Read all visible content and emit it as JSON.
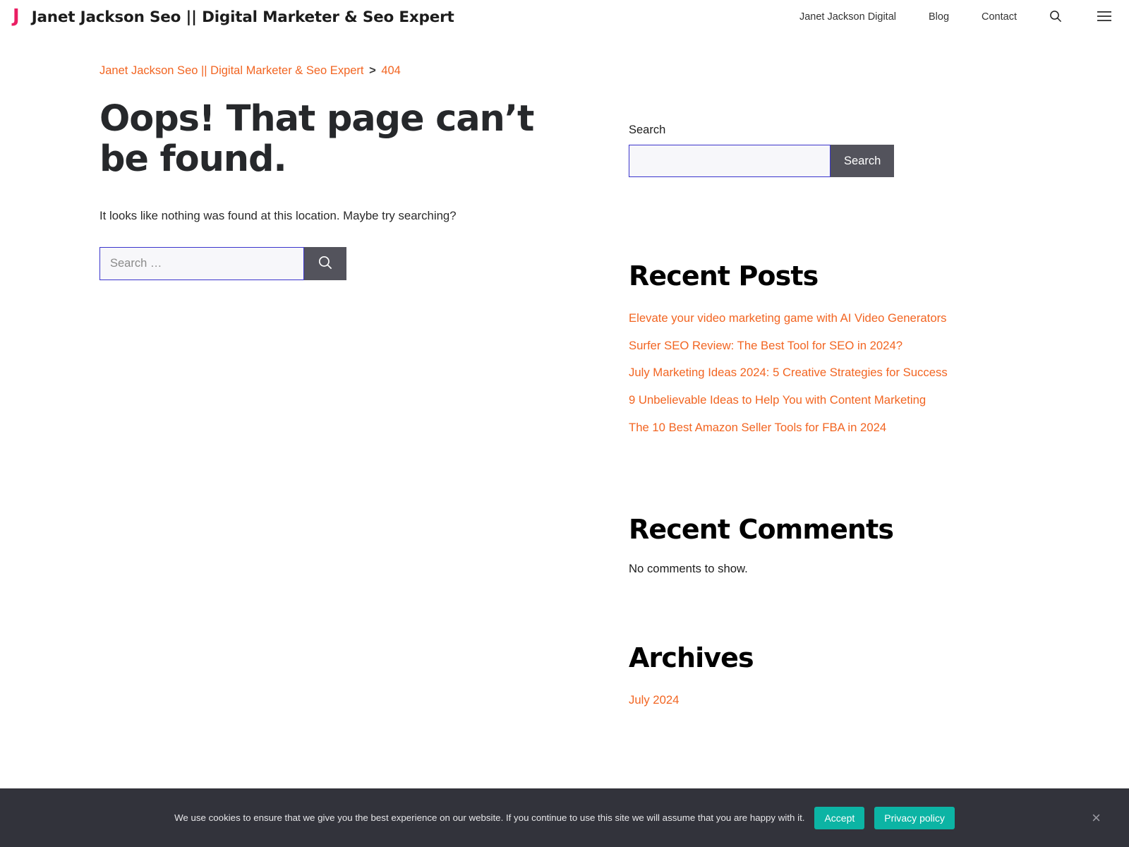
{
  "header": {
    "logo_letter": "J",
    "logo_color": "#ea1e63",
    "site_title": "Janet Jackson Seo || Digital Marketer & Seo Expert",
    "nav": [
      {
        "label": "Janet Jackson Digital"
      },
      {
        "label": "Blog"
      },
      {
        "label": "Contact"
      }
    ],
    "search_icon": "search-icon",
    "menu_icon": "hamburger-menu-icon"
  },
  "breadcrumb": {
    "home_label": "Janet Jackson Seo || Digital Marketer & Seo Expert",
    "separator": ">",
    "current_label": "404",
    "link_color": "#f26522"
  },
  "main": {
    "title": "Oops! That page can’t be found.",
    "lead": "It looks like nothing was found at this location. Maybe try searching?",
    "search": {
      "value": "",
      "placeholder": "Search …",
      "submit_icon": "search-icon",
      "border_color": "#3a34cc",
      "button_color": "#53535c"
    }
  },
  "sidebar": {
    "search_widget": {
      "label": "Search",
      "value": "",
      "placeholder": "",
      "button_label": "Search"
    },
    "recent_posts": {
      "title": "Recent Posts",
      "items": [
        {
          "label": "Elevate your video marketing game with AI Video Generators"
        },
        {
          "label": "Surfer SEO Review: The Best Tool for SEO in 2024?"
        },
        {
          "label": "July Marketing Ideas 2024: 5 Creative Strategies for Success"
        },
        {
          "label": "9 Unbelievable Ideas to Help You with Content Marketing"
        },
        {
          "label": "The 10 Best Amazon Seller Tools for FBA in 2024"
        }
      ]
    },
    "recent_comments": {
      "title": "Recent Comments",
      "empty_text": "No comments to show."
    },
    "archives": {
      "title": "Archives",
      "items": [
        {
          "label": "July 2024"
        }
      ]
    }
  },
  "cookie_banner": {
    "text": "We use cookies to ensure that we give you the best experience on our website. If you continue to use this site we will assume that you are happy with it.",
    "accept_label": "Accept",
    "privacy_label": "Privacy policy",
    "close_label": "×",
    "background": "#32333b",
    "button_color": "#0cb4a4"
  }
}
